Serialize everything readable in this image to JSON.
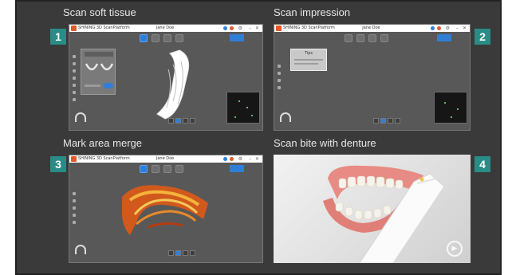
{
  "panels": [
    {
      "id": "1",
      "title": "Scan soft tissue"
    },
    {
      "id": "2",
      "title": "Scan impression"
    },
    {
      "id": "3",
      "title": "Mark area merge"
    },
    {
      "id": "4",
      "title": "Scan bite with denture"
    }
  ],
  "app": {
    "brand": "SHINING 3D ScanPlatform",
    "subject": "Jane Doe",
    "popup_title": "Tips"
  },
  "colors": {
    "frame": "#3a3a3a",
    "badge": "#2a8c86",
    "app_bg": "#585858",
    "accent_blue": "#2f7fd8",
    "brand_orange": "#e25a2a"
  },
  "icons": {
    "arch": "arch-icon",
    "play": "play-icon"
  }
}
